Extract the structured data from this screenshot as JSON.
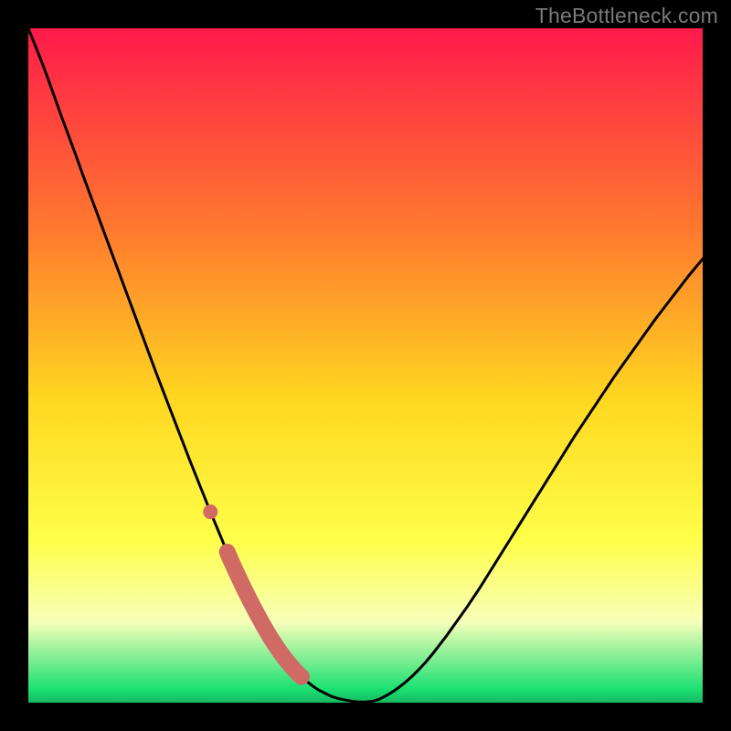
{
  "watermark": "TheBottleneck.com",
  "colors": {
    "frame": "#000000",
    "gradient_top": "#ff1a4b",
    "gradient_mid_upper": "#ff7a2e",
    "gradient_mid": "#ffd720",
    "gradient_mid_lower": "#ffff4a",
    "gradient_pale": "#f7ffba",
    "gradient_green": "#1be072",
    "curve": "#000000",
    "marker": "#cf6a64"
  },
  "chart_data": {
    "type": "line",
    "title": "",
    "xlabel": "",
    "ylabel": "",
    "xlim": [
      0,
      100
    ],
    "ylim": [
      0,
      100
    ],
    "x": [
      0,
      1,
      2,
      3,
      4,
      5,
      6,
      7,
      8,
      9,
      10,
      11,
      12,
      13,
      14,
      15,
      16,
      17,
      18,
      19,
      20,
      21,
      22,
      23,
      24,
      25,
      26,
      27,
      28,
      29,
      30,
      31,
      32,
      33,
      34,
      35,
      36,
      37,
      38,
      39,
      40,
      41,
      42,
      43,
      44,
      45,
      46,
      47,
      48,
      49,
      50,
      51,
      52,
      53,
      54,
      55,
      56,
      57,
      58,
      59,
      60,
      61,
      62,
      63,
      64,
      65,
      66,
      67,
      68,
      69,
      70,
      71,
      72,
      73,
      74,
      75,
      76,
      77,
      78,
      79,
      80,
      81,
      82,
      83,
      84,
      85,
      86,
      87,
      88,
      89,
      90,
      91,
      92,
      93,
      94,
      95,
      96,
      97,
      98,
      99,
      100
    ],
    "values": [
      100,
      97.5,
      95,
      92.3,
      89.5,
      86.7,
      84,
      81.3,
      78.5,
      75.8,
      73.1,
      70.4,
      67.7,
      65,
      62.3,
      59.6,
      56.9,
      54.2,
      51.5,
      48.8,
      46.2,
      43.6,
      41,
      38.4,
      35.8,
      33.3,
      30.8,
      28.3,
      25.9,
      23.5,
      21.2,
      19,
      16.9,
      14.9,
      13,
      11.2,
      9.5,
      8,
      6.6,
      5.4,
      4.3,
      3.4,
      2.6,
      1.9,
      1.4,
      0.9,
      0.6,
      0.4,
      0.2,
      0.1,
      0.1,
      0.2,
      0.5,
      1,
      1.6,
      2.3,
      3.1,
      4,
      5,
      6.1,
      7.3,
      8.6,
      9.9,
      11.3,
      12.7,
      14.1,
      15.6,
      17.1,
      18.7,
      20.3,
      21.9,
      23.5,
      25.1,
      26.7,
      28.3,
      29.9,
      31.5,
      33.1,
      34.7,
      36.3,
      37.9,
      39.5,
      41,
      42.5,
      44,
      45.5,
      47,
      48.5,
      49.9,
      51.3,
      52.7,
      54.1,
      55.5,
      56.9,
      58.2,
      59.5,
      60.8,
      62.1,
      63.4,
      64.6,
      65.8
    ],
    "optimal_range_x": [
      29.5,
      40.5
    ],
    "isolated_marker_x": 27
  }
}
